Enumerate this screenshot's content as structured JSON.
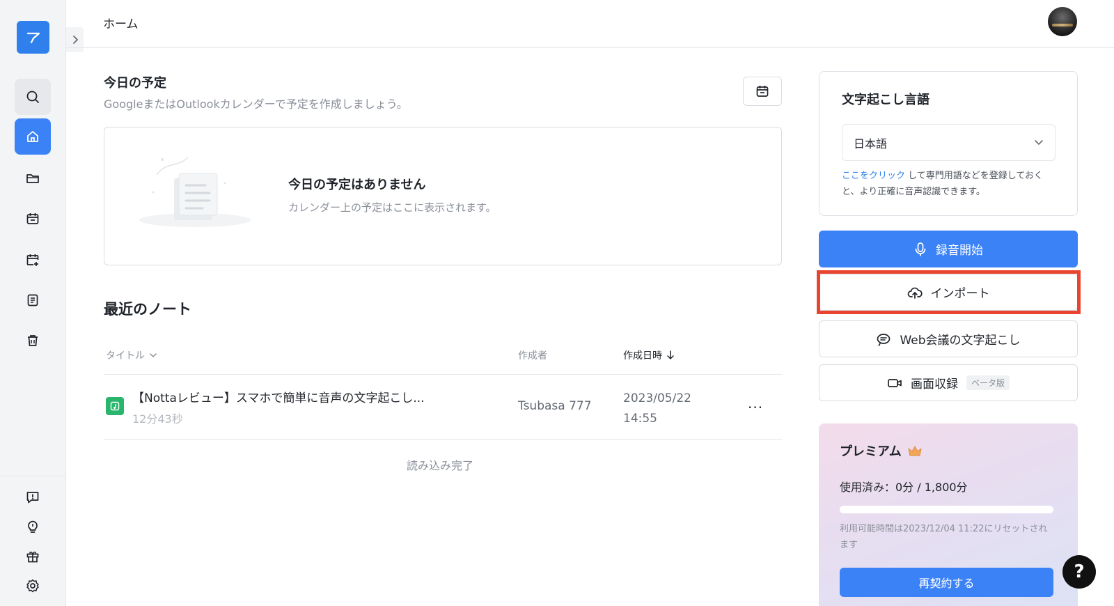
{
  "header": {
    "title": "ホーム"
  },
  "today": {
    "title": "今日の予定",
    "subtitle": "GoogleまたはOutlookカレンダーで予定を作成しましょう。",
    "empty_title": "今日の予定はありません",
    "empty_subtitle": "カレンダー上の予定はここに表示されます。"
  },
  "notes": {
    "title": "最近のノート",
    "columns": {
      "title": "タイトル",
      "author": "作成者",
      "created": "作成日時"
    },
    "rows": [
      {
        "title": "【Nottaレビュー】スマホで簡単に音声の文字起こし...",
        "duration": "12分43秒",
        "author": "Tsubasa 777",
        "date": "2023/05/22",
        "time": "14:55",
        "more": "···"
      }
    ],
    "load_done": "読み込み完了"
  },
  "language": {
    "title": "文字起こし言語",
    "selected": "日本語",
    "note_link": "ここをクリック",
    "note_rest": " して専門用語などを登録しておくと、より正確に音声認識できます。"
  },
  "actions": {
    "record": "録音開始",
    "import": "インポート",
    "web": "Web会議の文字起こし",
    "screen": "画面収録",
    "beta": "ベータ版"
  },
  "premium": {
    "title": "プレミアム",
    "usage": "使用済み：0分 / 1,800分",
    "usage_fraction": 0,
    "note": "利用可能時間は2023/12/04 11:22にリセットされます",
    "renew": "再契約する"
  },
  "help": {
    "label": "?"
  },
  "colors": {
    "accent": "#3b82f6",
    "highlight": "#e8442f",
    "note_icon": "#2ab56c"
  }
}
